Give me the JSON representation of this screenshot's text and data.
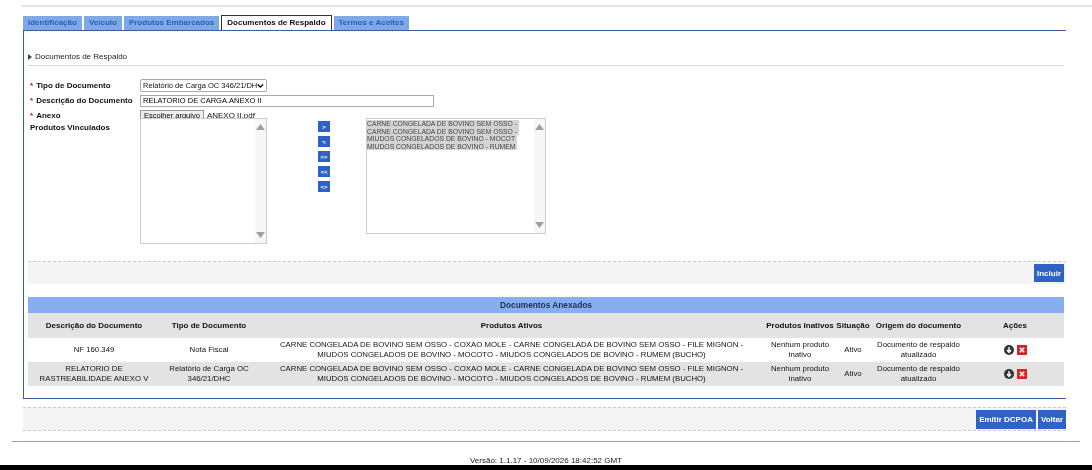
{
  "tabs": [
    {
      "label": "Identificação",
      "selected": false
    },
    {
      "label": "Veículo",
      "selected": false
    },
    {
      "label": "Produtos Embarcados",
      "selected": false
    },
    {
      "label": "Documentos de Respaldo",
      "selected": true
    },
    {
      "label": "Termos e Aceites",
      "selected": false
    }
  ],
  "section_title": "Documentos de Respaldo",
  "form": {
    "tipo": {
      "marker": "*",
      "label": "Tipo de Documento",
      "value": "Relatório de Carga OC 346/21/DH"
    },
    "descricao": {
      "marker": "*",
      "label": "Descrição do Documento",
      "value": "RELATORIO DE CARGA.ANEXO II"
    },
    "anexo": {
      "marker": "*",
      "label": "Anexo",
      "button": "Escolher arquivo",
      "file": "ANEXO II.pdf"
    },
    "produtos": {
      "label": "Produtos Vinculados",
      "move_buttons": [
        ">",
        "<",
        ">>",
        "<<",
        "<>"
      ],
      "selected_items": [
        {
          "text": "CARNE CONGELADA DE BOVINO SEM OSSO -",
          "selected": true
        },
        {
          "text": "CARNE CONGELADA DE BOVINO SEM OSSO -",
          "selected": true
        },
        {
          "text": "MIUDOS CONGELADOS DE BOVINO - MOCOT",
          "selected": true
        },
        {
          "text": "MIUDOS CONGELADOS DE BOVINO - RUMEM",
          "selected": true
        }
      ]
    }
  },
  "include_button": "Incluir",
  "table": {
    "title": "Documentos Anexados",
    "columns": [
      "Descrição do Documento",
      "Tipo de Documento",
      "Produtos Ativos",
      "Produtos Inativos",
      "Situação",
      "Origem do documento",
      "Ações"
    ],
    "rows": [
      {
        "descricao": "NF 160.349",
        "tipo": "Nota Fiscal",
        "ativos": "CARNE CONGELADA DE BOVINO SEM OSSO - COXAO MOLE - CARNE CONGELADA DE BOVINO SEM OSSO - FILE MIGNON - MIUDOS CONGELADOS DE BOVINO - MOCOTO - MIUDOS CONGELADOS DE BOVINO - RUMEM (BUCHO)",
        "inativos": "Nenhum produto inativo",
        "situacao": "Ativo",
        "origem": "Documento de respaldo atualizado"
      },
      {
        "descricao": "RELATORIO DE RASTREABILIDADE ANEXO V",
        "tipo": "Relatório de Carga OC 346/21/DHC",
        "ativos": "CARNE CONGELADA DE BOVINO SEM OSSO - COXAO MOLE - CARNE CONGELADA DE BOVINO SEM OSSO - FILE MIGNON - MIUDOS CONGELADOS DE BOVINO - MOCOTO - MIUDOS CONGELADOS DE BOVINO - RUMEM (BUCHO)",
        "inativos": "Nenhum produto inativo",
        "situacao": "Ativo",
        "origem": "Documento de respaldo atualizado"
      }
    ]
  },
  "footer_buttons": [
    "Emitir DCPOA",
    "Voltar"
  ],
  "version": "Versão: 1.1.17 - 10/09/2026 18:42:52 GMT"
}
